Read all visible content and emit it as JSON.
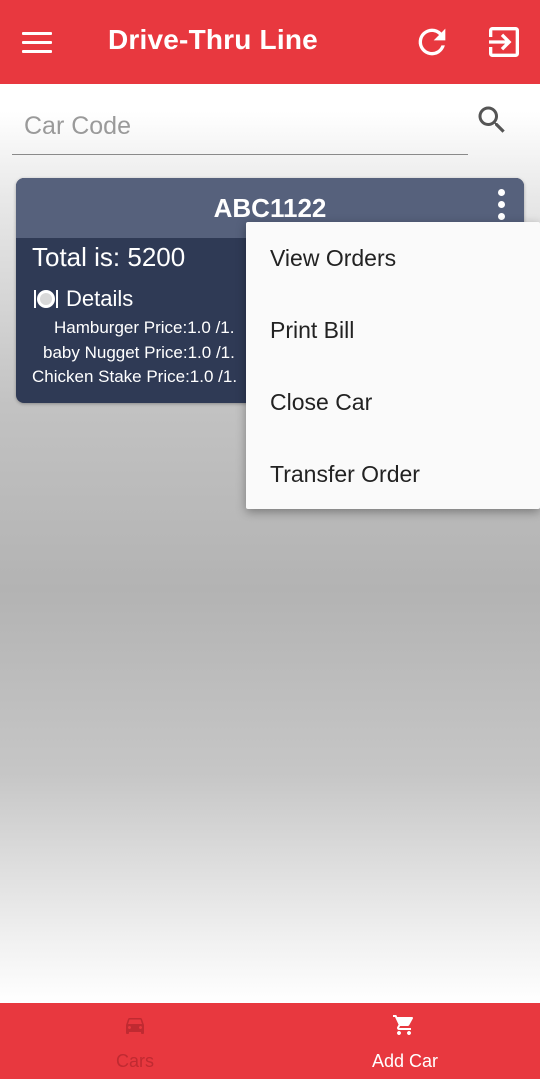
{
  "appbar": {
    "title": "Drive-Thru Line",
    "menu_icon": "hamburger-menu-icon",
    "refresh_icon": "refresh-icon",
    "exit_icon": "exit-to-app-icon"
  },
  "search": {
    "placeholder": "Car Code",
    "value": "",
    "icon": "search-icon"
  },
  "car_card": {
    "code": "ABC1122",
    "total": "Total is: 5200",
    "details_label": "Details",
    "items": [
      "Hamburger Price:1.0 /1.",
      "baby Nugget Price:1.0 /1.",
      "Chicken Stake Price:1.0 /1."
    ]
  },
  "popup_menu": {
    "items": [
      "View Orders",
      "Print Bill",
      "Close Car",
      "Transfer Order"
    ]
  },
  "bottom_nav": {
    "items": [
      {
        "label": "Cars",
        "icon": "car-icon",
        "active": true
      },
      {
        "label": "Add Car",
        "icon": "cart-icon",
        "active": false
      }
    ]
  },
  "colors": {
    "primary": "#e8383f",
    "card_body": "#2f3a55",
    "card_header": "#56617c",
    "nav_active": "#c02a31",
    "nav_inactive": "#ffffff"
  }
}
